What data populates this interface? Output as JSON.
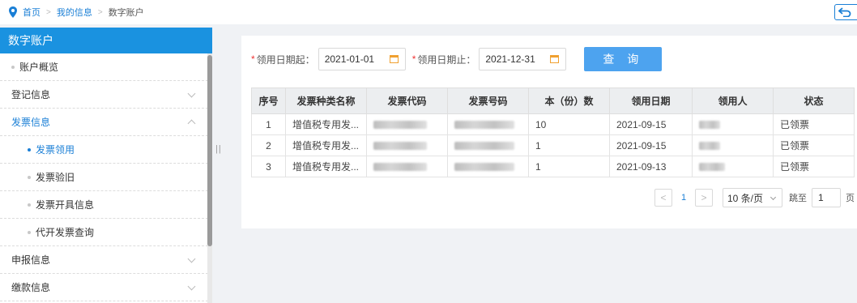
{
  "breadcrumb": {
    "items": [
      "首页",
      "我的信息",
      "数字账户"
    ]
  },
  "sidebar": {
    "title": "数字账户",
    "items": [
      {
        "label": "账户概览"
      },
      {
        "label": "登记信息"
      },
      {
        "label": "发票信息"
      },
      {
        "label": "发票领用"
      },
      {
        "label": "发票验旧"
      },
      {
        "label": "发票开具信息"
      },
      {
        "label": "代开发票查询"
      },
      {
        "label": "申报信息"
      },
      {
        "label": "缴款信息"
      }
    ]
  },
  "filters": {
    "start_label": "领用日期起：",
    "start_value": "2021-01-01",
    "end_label": "领用日期止：",
    "end_value": "2021-12-31",
    "required_mark": "*",
    "query_label": "查 询"
  },
  "table": {
    "headers": [
      "序号",
      "发票种类名称",
      "发票代码",
      "发票号码",
      "本（份）数",
      "领用日期",
      "领用人",
      "状态"
    ],
    "rows": [
      {
        "no": "1",
        "type": "增值税专用发...",
        "count": "10",
        "date": "2021-09-15",
        "status": "已领票"
      },
      {
        "no": "2",
        "type": "增值税专用发...",
        "count": "1",
        "date": "2021-09-15",
        "status": "已领票"
      },
      {
        "no": "3",
        "type": "增值税专用发...",
        "count": "1",
        "date": "2021-09-13",
        "status": "已领票"
      }
    ]
  },
  "pagination": {
    "prev": "<",
    "current": "1",
    "next": ">",
    "page_size": "10 条/页",
    "jump_label": "跳至",
    "jump_value": "1",
    "unit": "页"
  },
  "colors": {
    "accent": "#1a92e0",
    "link": "#1a7fd6",
    "button": "#4da3ef"
  }
}
